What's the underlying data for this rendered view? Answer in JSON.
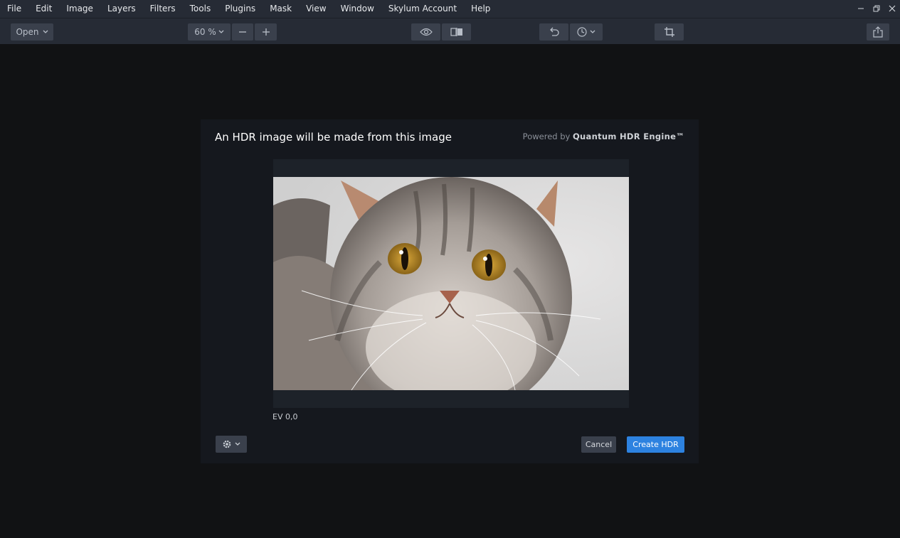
{
  "menu": {
    "items": [
      "File",
      "Edit",
      "Image",
      "Layers",
      "Filters",
      "Tools",
      "Plugins",
      "Mask",
      "View",
      "Window",
      "Skylum Account",
      "Help"
    ]
  },
  "window_controls": [
    "minimize-icon",
    "restore-icon",
    "close-icon"
  ],
  "toolbar": {
    "open_label": "Open",
    "zoom_label": "60 %",
    "icons": [
      "chevron-down-icon",
      "minus-icon",
      "plus-icon",
      "eye-icon",
      "compare-icon",
      "undo-icon",
      "history-icon",
      "crop-icon",
      "share-icon"
    ]
  },
  "dialog": {
    "title": "An HDR image will be made from this image",
    "powered_prefix": "Powered by",
    "powered_engine": "Quantum HDR Engine™",
    "ev_label": "EV 0,0",
    "cancel_label": "Cancel",
    "create_label": "Create HDR"
  },
  "colors": {
    "accent": "#2d82e0",
    "background": "#111214",
    "toolbar": "#262b35",
    "dialog": "#15181e"
  }
}
